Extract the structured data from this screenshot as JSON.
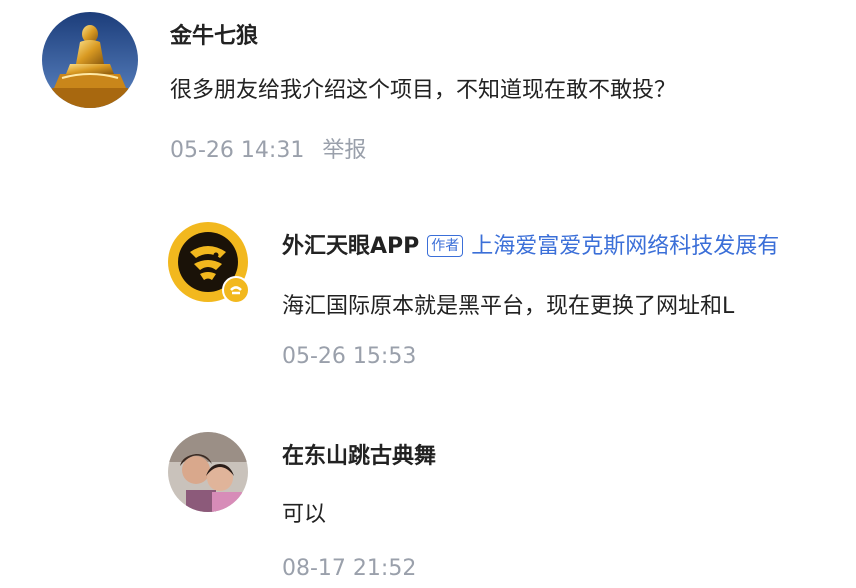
{
  "comments": [
    {
      "username": "金牛七狼",
      "text": "很多朋友给我介绍这个项目，不知道现在敢不敢投？",
      "timestamp": "05-26 14:31",
      "report_label": "举报"
    },
    {
      "username": "外汇天眼APP",
      "author_badge": "作者",
      "org": "上海爱富爱克斯网络科技发展有",
      "text": "海汇国际原本就是黑平台，现在更换了网址和L",
      "timestamp": "05-26 15:53"
    },
    {
      "username": "在东山跳古典舞",
      "text": "可以",
      "timestamp": "08-17 21:52"
    }
  ],
  "colors": {
    "text": "#222222",
    "meta": "#9aa0ab",
    "brand_blue": "#3b6fd8",
    "eagle_gold": "#f2b81e"
  },
  "icons": [
    "buddha-statue-avatar",
    "eagle-logo-avatar",
    "verified-badge-icon",
    "couple-photo-avatar"
  ]
}
